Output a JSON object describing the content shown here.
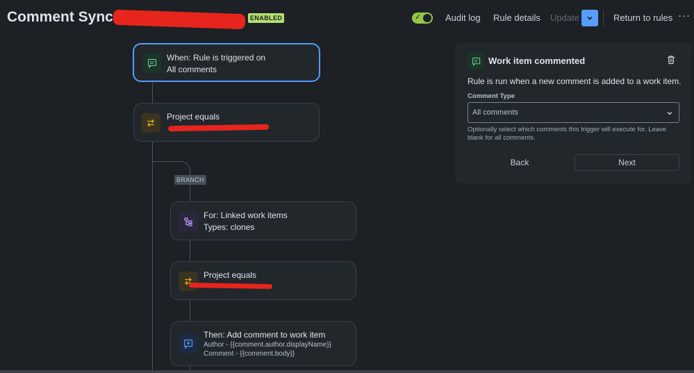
{
  "header": {
    "title": "Comment Sync in",
    "status_badge": "ENABLED",
    "audit_log": "Audit log",
    "rule_details": "Rule details",
    "update": "Update",
    "return_to_rules": "Return to rules",
    "more": "···",
    "toggle_on": true
  },
  "flow": {
    "trigger": {
      "line1": "When: Rule is triggered on",
      "line2": "All comments",
      "icon": "comment-icon"
    },
    "condition1": {
      "line1": "Project equals",
      "icon": "swap-icon"
    },
    "branch_label": "BRANCH",
    "branch_for": {
      "line1": "For: Linked work items",
      "line2": "Types: clones",
      "icon": "branch-icon"
    },
    "condition2": {
      "line1": "Project equals",
      "icon": "swap-icon"
    },
    "action": {
      "line1": "Then: Add comment to work item",
      "line2": "Author - {{comment.author.displayName}}",
      "line3": "Comment - {{comment.body}}",
      "icon": "add-comment-icon"
    }
  },
  "panel": {
    "title": "Work item commented",
    "description": "Rule is run when a new comment is added to a work item.",
    "field_label": "Comment Type",
    "field_value": "All comments",
    "help": "Optionally select which comments this trigger will execute for. Leave blank for all comments.",
    "back": "Back",
    "next": "Next"
  },
  "colors": {
    "background": "#1d2125",
    "accent": "#579dff",
    "enabled": "#b3df72",
    "redaction": "#e8251c"
  }
}
